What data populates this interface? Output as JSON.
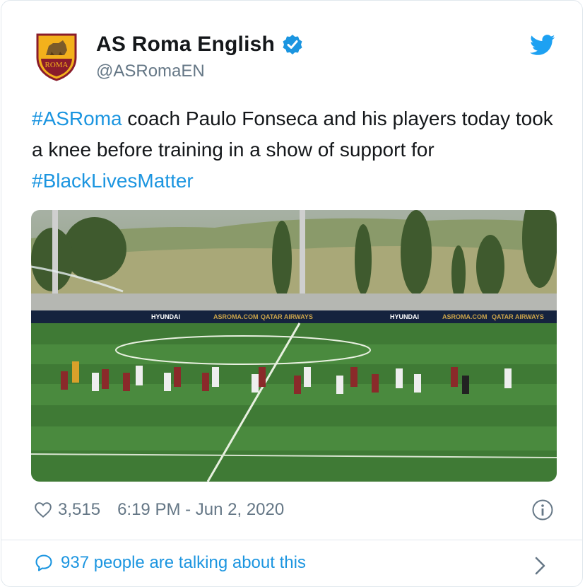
{
  "tweet": {
    "author_name": "AS Roma English",
    "author_handle": "@ASRomaEN",
    "text_segments": [
      {
        "text": "#ASRoma",
        "type": "hashtag"
      },
      {
        "text": " coach Paulo Fonseca and his players today took a knee before training in a show of support for ",
        "type": "plain"
      },
      {
        "text": "#BlackLivesMatter",
        "type": "hashtag"
      }
    ],
    "likes": "3,515",
    "timestamp": "6:19 PM - Jun 2, 2020",
    "talking_about": "937 people are talking about this",
    "crest_text": "ROMA",
    "media_banners": [
      "HYUNDAI",
      "ASROMA.COM",
      "QATAR AIRWAYS",
      "HYUNDAI",
      "ASROMA.COM",
      "QATAR AIRWAYS"
    ]
  },
  "icons": {
    "verified": "verified-badge-icon",
    "bird": "twitter-bird-icon",
    "like": "heart-icon",
    "info": "info-icon",
    "reply": "speech-bubble-icon",
    "chevron": "chevron-right-icon"
  },
  "colors": {
    "accent": "#1b95e0",
    "secondary_text": "#657786",
    "primary_text": "#14171a",
    "border": "#e1e8ed"
  }
}
